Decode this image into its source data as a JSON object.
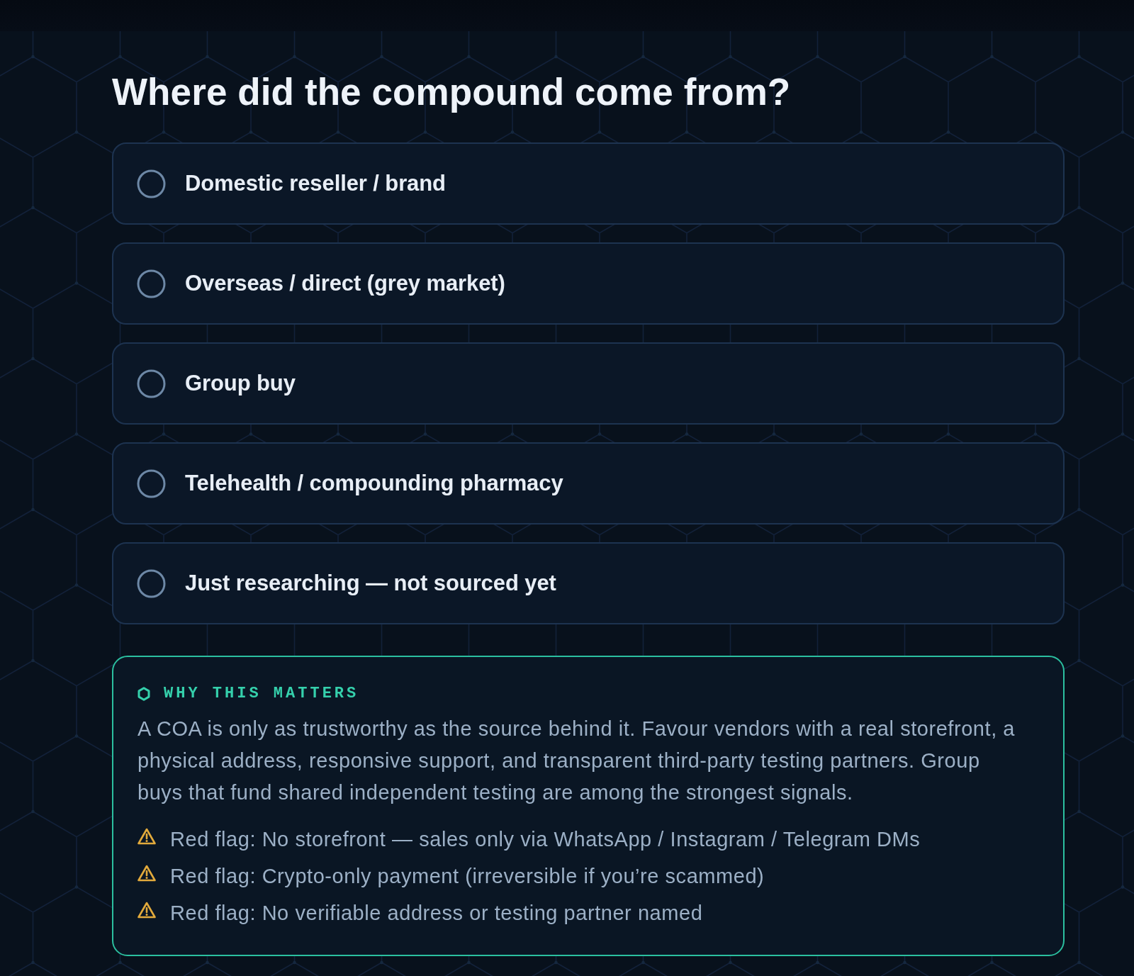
{
  "question": {
    "title": "Where did the compound come from?"
  },
  "options": [
    {
      "label": "Domestic reseller / brand",
      "selected": false
    },
    {
      "label": "Overseas / direct (grey market)",
      "selected": false
    },
    {
      "label": "Group buy",
      "selected": false
    },
    {
      "label": "Telehealth / compounding pharmacy",
      "selected": false
    },
    {
      "label": "Just researching — not sourced yet",
      "selected": false
    }
  ],
  "info": {
    "heading": "WHY THIS MATTERS",
    "body": "A COA is only as trustworthy as the source behind it. Favour vendors with a real storefront, a physical address, responsive support, and transparent third-party testing partners. Group buys that fund shared independent testing are among the strongest signals.",
    "flags": [
      "Red flag: No storefront — sales only via WhatsApp / Instagram / Telegram DMs",
      "Red flag: Crypto-only payment (irreversible if you’re scammed)",
      "Red flag: No verifiable address or testing partner named"
    ]
  }
}
